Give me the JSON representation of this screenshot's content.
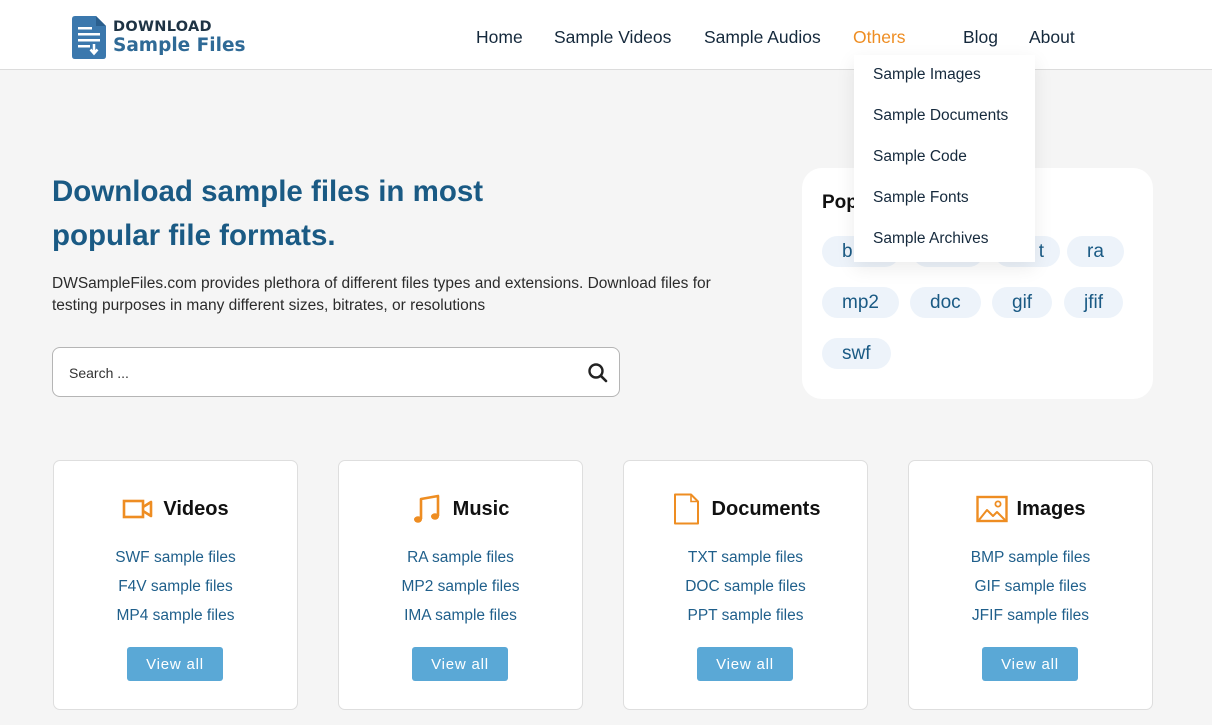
{
  "header": {
    "logo": {
      "line1": "DOWNLOAD",
      "line2": "Sample Files"
    },
    "nav": [
      {
        "label": "Home",
        "active": false
      },
      {
        "label": "Sample Videos",
        "active": false
      },
      {
        "label": "Sample Audios",
        "active": false
      },
      {
        "label": "Others",
        "active": true
      },
      {
        "label": "Blog",
        "active": false
      },
      {
        "label": "About",
        "active": false
      }
    ],
    "accent_color": "#ee8d22"
  },
  "dropdown": {
    "items": [
      "Sample Images",
      "Sample Documents",
      "Sample Code",
      "Sample Fonts",
      "Sample Archives"
    ]
  },
  "hero": {
    "title": "Download sample files in most popular file formats.",
    "description": "DWSampleFiles.com provides plethora of different files types and extensions. Download files for testing purposes in many different sizes, bitrates, or resolutions",
    "search": {
      "placeholder": "Search ...",
      "value": "",
      "icon": "search-icon"
    }
  },
  "popular": {
    "title_visible": "Pop",
    "tags": [
      "b",
      "",
      "t",
      "ra",
      "mp2",
      "doc",
      "gif",
      "jfif",
      "swf"
    ]
  },
  "cards": [
    {
      "icon": "video-camera-icon",
      "title": "Videos",
      "links": [
        "SWF sample files",
        "F4V sample files",
        "MP4 sample files"
      ],
      "button": "View all"
    },
    {
      "icon": "music-note-icon",
      "title": "Music",
      "links": [
        "RA sample files",
        "MP2 sample files",
        "IMA sample files"
      ],
      "button": "View all"
    },
    {
      "icon": "document-icon",
      "title": "Documents",
      "links": [
        "TXT sample files",
        "DOC sample files",
        "PPT sample files"
      ],
      "button": "View all"
    },
    {
      "icon": "image-icon",
      "title": "Images",
      "links": [
        "BMP sample files",
        "GIF sample files",
        "JFIF sample files"
      ],
      "button": "View all"
    }
  ],
  "colors": {
    "primary": "#1a5a84",
    "accent": "#ee8d22",
    "button": "#5aa8d6",
    "background": "#f5f5f5"
  }
}
